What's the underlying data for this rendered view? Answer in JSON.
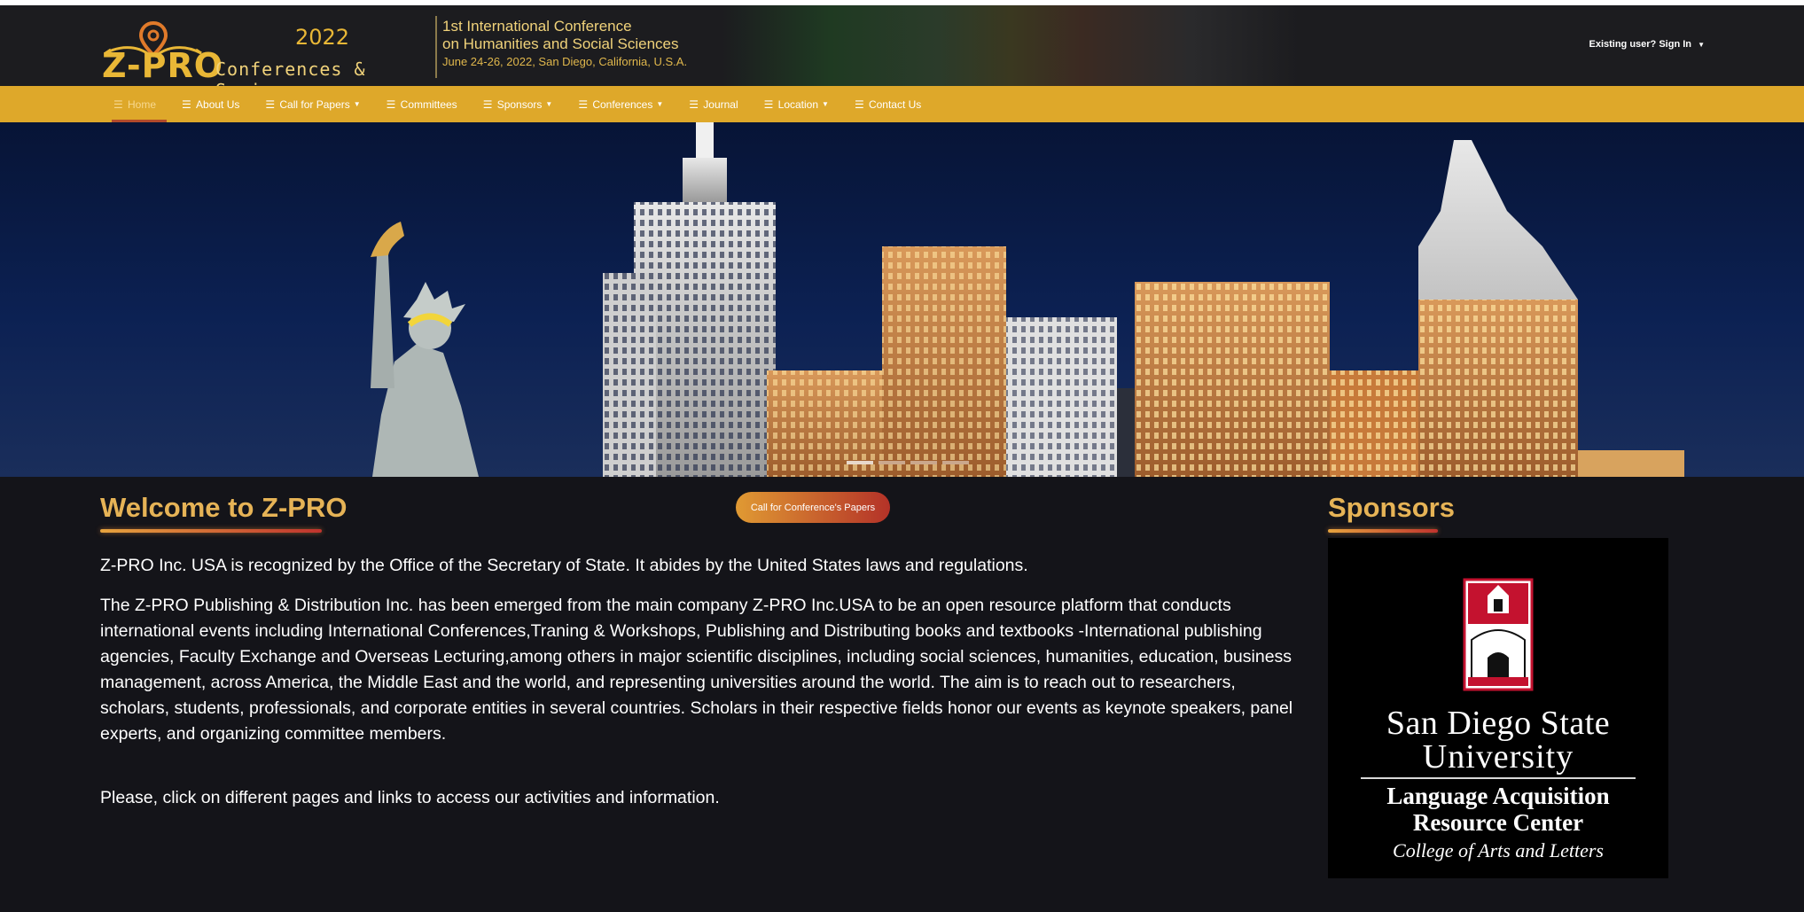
{
  "brand": {
    "logo_text": "Z-PRO",
    "year": "2022",
    "tagline": "Conferences & Seminars",
    "accent_color": "#e9b736"
  },
  "conference": {
    "title_line1": "1st International Conference",
    "title_line2": "on Humanities and Social Sciences",
    "date_location": "June 24-26, 2022, San Diego, California, U.S.A."
  },
  "account": {
    "signin_label": "Existing user? Sign In"
  },
  "nav": {
    "bar_color": "#dea82a",
    "items": [
      {
        "label": "Home",
        "icon": "bars-icon",
        "active": true
      },
      {
        "label": "About Us",
        "icon": "bars-icon"
      },
      {
        "label": "Call for Papers",
        "icon": "bars-icon",
        "dropdown": true
      },
      {
        "label": "Committees",
        "icon": "bars-icon"
      },
      {
        "label": "Sponsors",
        "icon": "bars-icon",
        "dropdown": true
      },
      {
        "label": "Conferences",
        "icon": "bars-icon",
        "dropdown": true
      },
      {
        "label": "Journal",
        "icon": "bars-icon"
      },
      {
        "label": "Location",
        "icon": "bars-icon",
        "dropdown": true
      },
      {
        "label": "Contact Us",
        "icon": "bars-icon"
      }
    ]
  },
  "hero": {
    "slide_count": 4,
    "active_slide": 1
  },
  "main": {
    "welcome_title": "Welcome to Z-PRO",
    "cta_label": "Call for Conference's Papers",
    "paragraph1": "Z-PRO Inc. USA is recognized by the Office of the Secretary of State. It abides by the United States laws and regulations.",
    "paragraph2": "The Z-PRO Publishing & Distribution Inc. has been emerged from the main company Z-PRO Inc.USA to be an open resource platform that conducts international events including International Conferences,Traning & Workshops, Publishing and Distributing books and textbooks -International publishing agencies, Faculty Exchange and Overseas Lecturing,among others in major scientific disciplines, including social sciences, humanities, education, business management, across America, the Middle East and the world, and representing universities around the world. The aim is to reach out to researchers, scholars, students, professionals, and corporate entities in several countries. Scholars in their respective fields honor our events as keynote speakers, panel experts, and organizing committee members.",
    "paragraph3": "Please, click on different pages and links to access our activities and information."
  },
  "sponsors": {
    "title": "Sponsors",
    "sponsor": {
      "name_line1": "San Diego State",
      "name_line2": "University",
      "center_line1": "Language Acquisition",
      "center_line2": "Resource Center",
      "college": "College of Arts and Letters"
    }
  }
}
